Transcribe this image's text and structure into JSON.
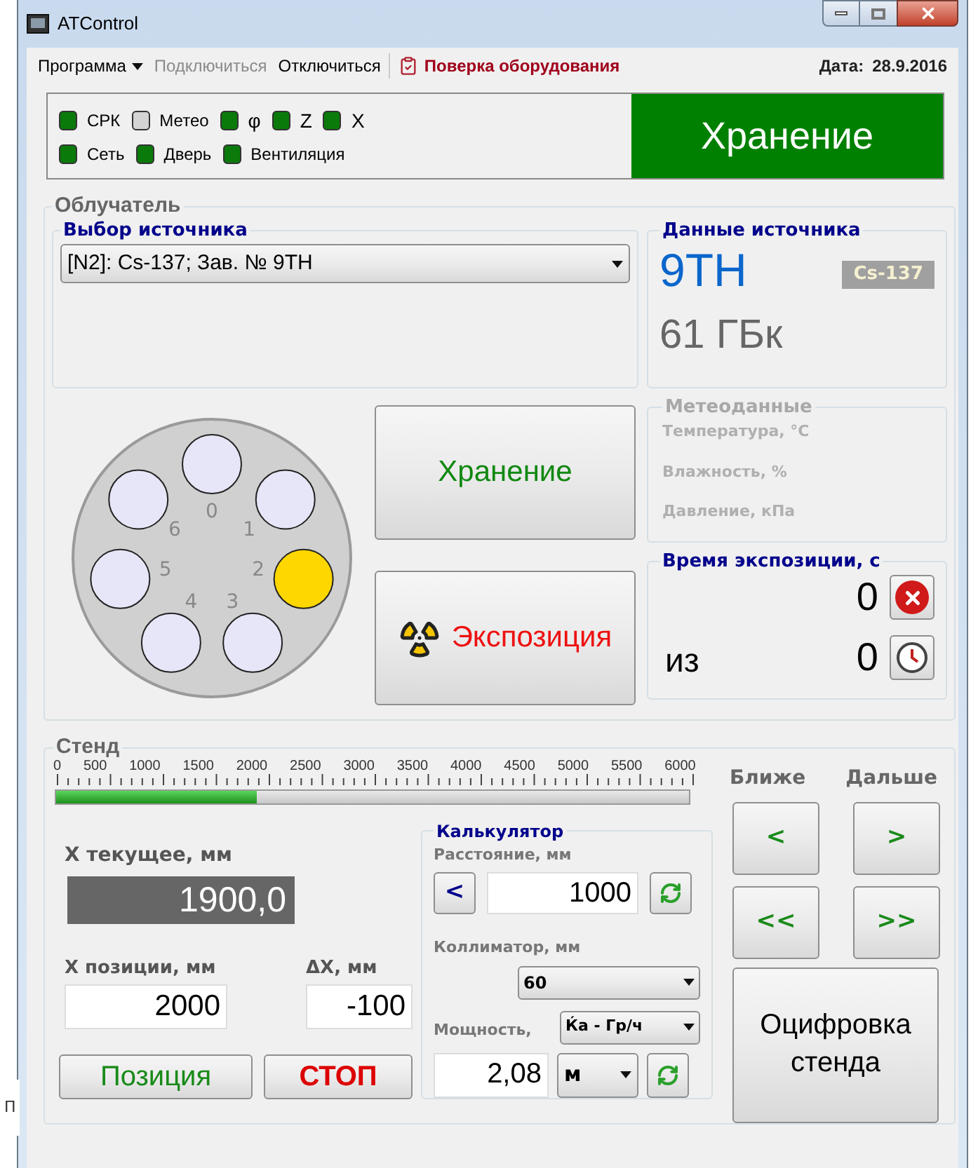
{
  "window": {
    "title": "ATControl"
  },
  "menu": [
    {
      "label": "Программа",
      "kind": "dropdown",
      "disabled": false
    },
    {
      "label": "Подключиться",
      "kind": "plain",
      "disabled": true
    },
    {
      "label": "Отключиться",
      "kind": "plain",
      "disabled": false
    },
    {
      "label": "Поверка оборудования",
      "kind": "action",
      "disabled": false
    }
  ],
  "date": {
    "label": "Дата:",
    "value": "28.9.2016"
  },
  "indicator_rows": [
    [
      {
        "label": "СРК",
        "on": true
      },
      {
        "label": "Метео",
        "on": false
      },
      {
        "label": "φ",
        "on": true
      },
      {
        "label": "Z",
        "on": true
      },
      {
        "label": "X",
        "on": true
      }
    ],
    [
      {
        "label": "Сеть",
        "on": true
      },
      {
        "label": "Дверь",
        "on": true
      },
      {
        "label": "Вентиляция",
        "on": true
      }
    ]
  ],
  "mode_banner": "Хранение",
  "irradiator": {
    "title": "Облучатель",
    "source_select": {
      "title": "Выбор источника",
      "value": "[N2]: Cs-137; Зав. № 9TH"
    },
    "turret": [
      {
        "label": "0",
        "selected": false
      },
      {
        "label": "1",
        "selected": false
      },
      {
        "label": "2",
        "selected": true
      },
      {
        "label": "3",
        "selected": false
      },
      {
        "label": "4",
        "selected": false
      },
      {
        "label": "5",
        "selected": false
      },
      {
        "label": "6",
        "selected": false
      }
    ],
    "storage_button": "Хранение",
    "exposure_button": "Экспозиция",
    "source_data": {
      "title": "Данные источника",
      "id": "9TH",
      "isotope": "Cs-137",
      "activity": "61 ГБк"
    },
    "meteo": {
      "title": "Метеоданные",
      "disabled": true,
      "fields": [
        "Температура, °C",
        "Влажность, %",
        "Давление, кПа"
      ]
    },
    "exposure_time": {
      "title": "Время экспозиции, с",
      "elapsed": "0",
      "of_label": "из",
      "total": "0"
    }
  },
  "stand": {
    "title": "Стенд",
    "scale_labels": [
      "0",
      "500",
      "1000",
      "1500",
      "2000",
      "2500",
      "3000",
      "3500",
      "4000",
      "4500",
      "5000",
      "5500",
      "6000"
    ],
    "level": 0.317,
    "x_current": {
      "label": "X текущее, мм",
      "value": "1900,0"
    },
    "x_position": {
      "label": "X позиции, мм",
      "value": "2000"
    },
    "delta_x": {
      "label": "ΔX, мм",
      "value": "-100"
    },
    "position_button": "Позиция",
    "stop_button": "СТОП",
    "closer": {
      "label": "Ближе",
      "buttons": [
        "<",
        "<<"
      ]
    },
    "farther": {
      "label": "Дальше",
      "buttons": [
        ">",
        ">>"
      ]
    },
    "digitize_button": "Оцифровка стенда",
    "calculator": {
      "title": "Калькулятор",
      "distance_label": "Расстояние, мм",
      "distance_back": "<",
      "distance": "1000",
      "collimator_label": "Коллиматор, мм",
      "collimator": "60",
      "power_label": "Мощность,",
      "power_unit": "Ќа - Гр/ч",
      "power": "2,08",
      "power_scale": "м"
    }
  },
  "background_fragment": "П"
}
